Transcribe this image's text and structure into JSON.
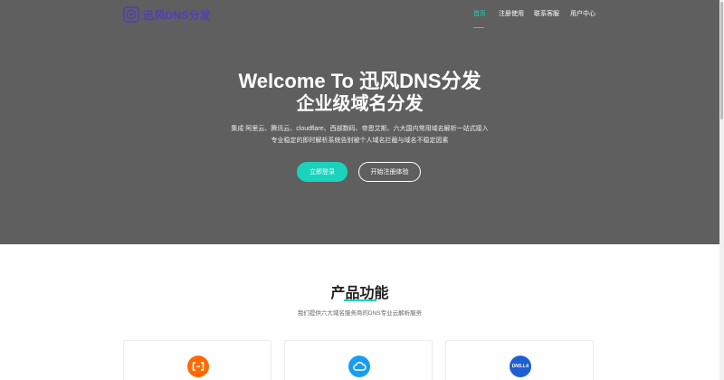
{
  "brand": {
    "name": "迅风DNS分发"
  },
  "nav": {
    "items": [
      {
        "label": "首页",
        "active": true
      },
      {
        "label": "注册使用",
        "active": false
      },
      {
        "label": "联系客服",
        "active": false
      },
      {
        "label": "用户中心",
        "active": false
      }
    ]
  },
  "hero": {
    "title_line1": "Welcome To 迅风DNS分发",
    "title_line2": "企业级域名分发",
    "desc_line1": "集成 阿里云、腾讯云、cloudflare、西部数码、帝恩艾斯、六大国内常用域名解析一站式接入",
    "desc_line2": "专业稳定的即时解析系统告别被个人域名拦截与域名不稳定因素",
    "primary_button": "立即登录",
    "secondary_button": "开始注册体验"
  },
  "features": {
    "title": "产品功能",
    "subtitle": "我们提供六大域名服务商的DNS专业云解析服务",
    "cards": [
      {
        "icon": "aliyun-icon"
      },
      {
        "icon": "tencent-cloud-icon"
      },
      {
        "icon": "dnsla-icon",
        "icon_text": "DNS.LA"
      }
    ]
  },
  "colors": {
    "accent": "#1bd2bd",
    "hero_bg": "#5f5f5f",
    "brand": "#4f3fb6"
  }
}
